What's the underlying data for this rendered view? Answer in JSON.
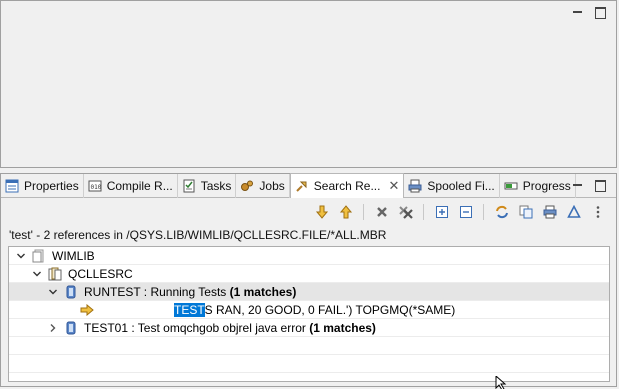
{
  "tabs": [
    {
      "label": "Properties",
      "icon": "properties-icon"
    },
    {
      "label": "Compile R...",
      "icon": "compile-icon"
    },
    {
      "label": "Tasks",
      "icon": "tasks-icon"
    },
    {
      "label": "Jobs",
      "icon": "jobs-icon"
    },
    {
      "label": "Search Re...",
      "icon": "search-icon",
      "active": true
    },
    {
      "label": "Spooled Fi...",
      "icon": "spooled-files-icon"
    },
    {
      "label": "Progress",
      "icon": "progress-icon"
    }
  ],
  "search": {
    "summary": "'test' - 2 references in /QSYS.LIB/WIMLIB/QCLLESRC.FILE/*ALL.MBR",
    "tree": {
      "library": "WIMLIB",
      "file": "QCLLESRC",
      "members": [
        {
          "name": "RUNTEST : Running Tests",
          "matches": "(1 matches)",
          "expanded": true,
          "match_line": {
            "highlight": "TEST",
            "rest": "S RAN, 20 GOOD, 0 FAIL.') TOPGMQ(*SAME)"
          }
        },
        {
          "name": "TEST01 : Test omqchgob objrel java error",
          "matches": "(1 matches)",
          "expanded": false
        }
      ]
    }
  },
  "colors": {
    "selection": "#0078d7",
    "selected_row": "#e5e5e5",
    "arrow_yellow": "#e8a317",
    "icon_blue": "#3b6fb6"
  }
}
